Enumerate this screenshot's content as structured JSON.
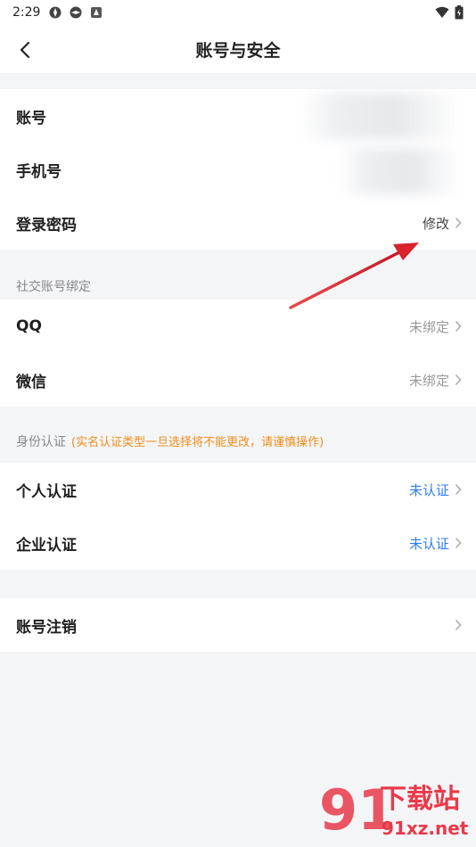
{
  "status_bar": {
    "time": "2:29"
  },
  "header": {
    "title": "账号与安全"
  },
  "account_group": {
    "items": [
      {
        "label": "账号",
        "value": ""
      },
      {
        "label": "手机号",
        "value": ""
      },
      {
        "label": "登录密码",
        "value": "修改"
      }
    ]
  },
  "social": {
    "section_title": "社交账号绑定",
    "items": [
      {
        "label": "QQ",
        "value": "未绑定"
      },
      {
        "label": "微信",
        "value": "未绑定"
      }
    ]
  },
  "identity": {
    "section_title": "身份认证",
    "warning": "(实名认证类型一旦选择将不能更改，请谨慎操作)",
    "items": [
      {
        "label": "个人认证",
        "value": "未认证"
      },
      {
        "label": "企业认证",
        "value": "未认证"
      }
    ]
  },
  "cancel_group": {
    "label": "账号注销"
  },
  "watermark": {
    "text_main": "下载站",
    "text_url": "91xz.net"
  },
  "colors": {
    "accent_blue": "#2f7cf6",
    "warning_orange": "#f08c1a",
    "arrow_red": "#d9232d"
  }
}
